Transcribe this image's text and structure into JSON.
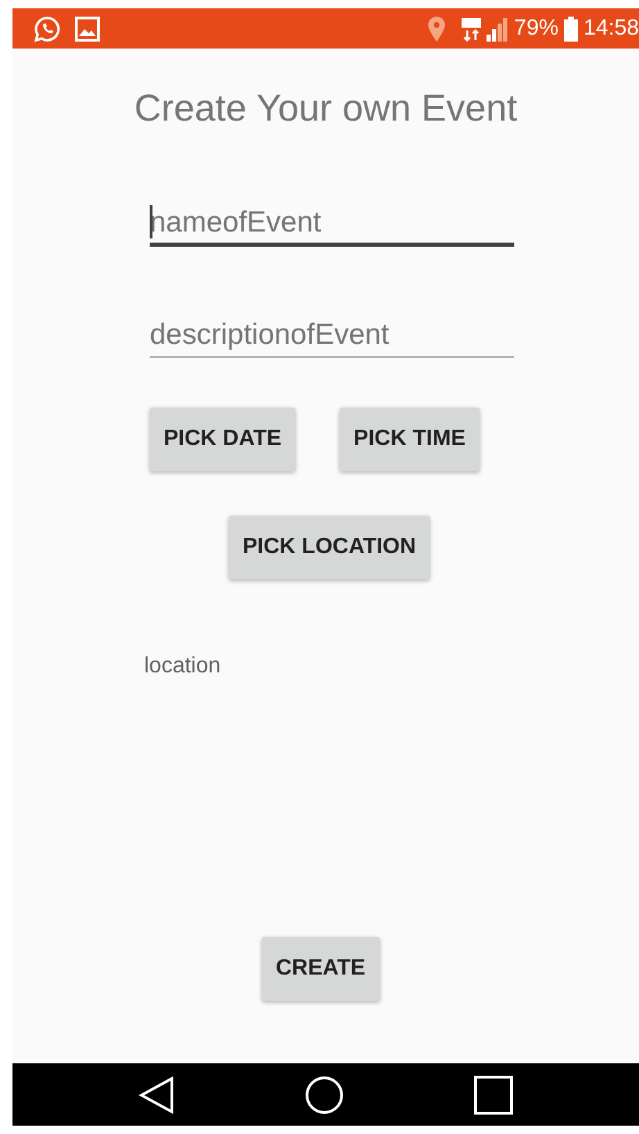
{
  "status_bar": {
    "battery": "79%",
    "time": "14:58"
  },
  "title": "Create Your own Event",
  "fields": [
    {
      "placeholder": "nameofEvent",
      "focused": true
    },
    {
      "placeholder": "descriptionofEvent",
      "focused": false
    }
  ],
  "picker_buttons": [
    {
      "label": "PICK DATE"
    },
    {
      "label": "PICK TIME"
    },
    {
      "label": "PICK LOCATION"
    }
  ],
  "location_label": "location",
  "create_button": "CREATE"
}
